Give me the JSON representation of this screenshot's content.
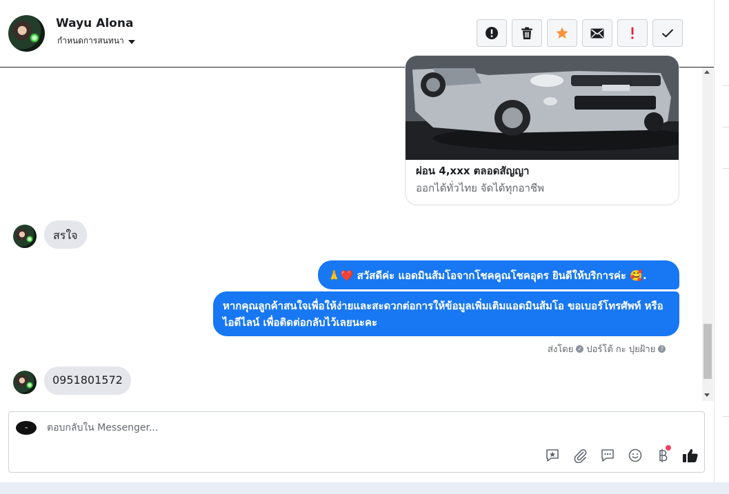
{
  "header": {
    "contact_name": "Wayu Alona",
    "assign_label": "กำหนดการสนทนา",
    "actions": [
      {
        "icon": "alert-circle-icon"
      },
      {
        "icon": "trash-icon"
      },
      {
        "icon": "star-icon",
        "color": "#f7923b"
      },
      {
        "icon": "envelope-icon"
      },
      {
        "icon": "spam-exclamation-icon",
        "color": "#e41e3f"
      },
      {
        "icon": "checkmark-icon"
      }
    ]
  },
  "messages": {
    "card": {
      "title": "ผ่อน 4,xxx ตลอดสัญญา",
      "subtitle": "ออกได้ทั่วไทย จัดได้ทุกอาชีพ"
    },
    "incoming_1": "สรใจ",
    "outgoing_1_emoji_prefix": "🙏❤️",
    "outgoing_1": "สวัสดีค่ะ แอดมินส้มโอจากโชคคูณโชคอุดร ยินดีให้บริการค่ะ",
    "outgoing_1_emoji_suffix": "🥰.",
    "outgoing_2": "หากคุณลูกค้าสนใจเพื่อให้ง่ายและสะดวกต่อการให้ข้อมูลเพิ่มเติมแอดมินส้มโอ ขอเบอร์โทรศัพท์ หรือ ไอดีไลน์ เพื่อติดต่อกลับไว้เลยนะคะ",
    "sent_by_label": "ส่งโดย",
    "sent_by_name": "ปอร์โต้ กะ ปุยฝ้าย",
    "incoming_2": "0951801572"
  },
  "composer": {
    "placeholder": "ตอบกลับใน Messenger...",
    "value": "",
    "tools": [
      "saved-reply-icon",
      "attachment-icon",
      "chat-bubble-icon",
      "emoji-icon",
      "baht-payment-icon",
      "thumbs-up-icon"
    ]
  },
  "colors": {
    "accent": "#1877f2",
    "incoming_bubble": "#e4e6eb"
  }
}
